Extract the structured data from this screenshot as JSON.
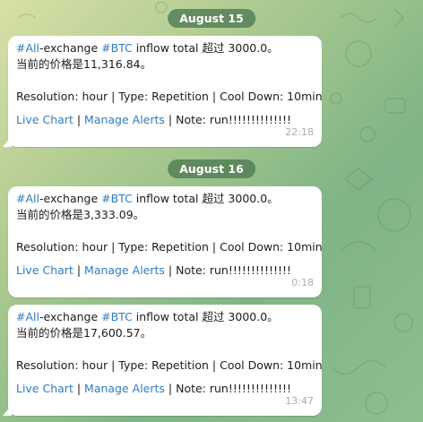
{
  "dates": [
    "August 15",
    "August 16"
  ],
  "messages": [
    {
      "tag_all": "#All",
      "exchange_text": "-exchange ",
      "tag_btc": "#BTC",
      "inflow_text": " inflow total  超过 3000.0。",
      "price_line": "当前的价格是11,316.84。",
      "resolution_line": "Resolution: hour | Type: Repetition | Cool Down: 10min",
      "live_chart": "Live Chart",
      "sep1": " | ",
      "manage_alerts": "Manage Alerts",
      "note": " | Note: run!!!!!!!!!!!!!!",
      "time": "22:18"
    },
    {
      "tag_all": "#All",
      "exchange_text": "-exchange ",
      "tag_btc": "#BTC",
      "inflow_text": " inflow total  超过 3000.0。",
      "price_line": "当前的价格是3,333.09。",
      "resolution_line": "Resolution: hour | Type: Repetition | Cool Down: 10min",
      "live_chart": "Live Chart",
      "sep1": " | ",
      "manage_alerts": "Manage Alerts",
      "note": " | Note: run!!!!!!!!!!!!!!",
      "time": "0:18"
    },
    {
      "tag_all": "#All",
      "exchange_text": "-exchange ",
      "tag_btc": "#BTC",
      "inflow_text": " inflow total  超过 3000.0。",
      "price_line": "当前的价格是17,600.57。",
      "resolution_line": "Resolution: hour | Type: Repetition | Cool Down: 10min",
      "live_chart": "Live Chart",
      "sep1": " | ",
      "manage_alerts": "Manage Alerts",
      "note": " | Note: run!!!!!!!!!!!!!!",
      "time": "13:47"
    }
  ],
  "colors": {
    "link": "#2f7dbf",
    "date_pill": "#527d54",
    "timestamp": "#a6aeb3"
  }
}
